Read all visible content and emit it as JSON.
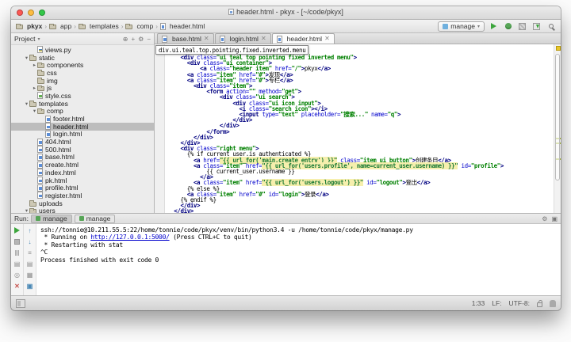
{
  "window": {
    "title": "header.html - pkyx - [~/code/pkyx]",
    "breadcrumbs": [
      "pkyx",
      "app",
      "templates",
      "comp",
      "header.html"
    ],
    "toolbar": {
      "run_config_label": "manage",
      "icons": [
        "run-icon",
        "debug-icon",
        "coverage-icon",
        "deploy-icon",
        "search-everywhere-icon"
      ]
    }
  },
  "project_panel": {
    "title": "Project",
    "header_icons": [
      "locate-icon",
      "scroll-to-source-icon",
      "gear-icon",
      "collapse-all-icon"
    ],
    "tree": [
      {
        "label": "views.py",
        "depth": 3,
        "icon": "py"
      },
      {
        "label": "static",
        "depth": 2,
        "icon": "folder",
        "arrow": "down"
      },
      {
        "label": "components",
        "depth": 3,
        "icon": "folder",
        "arrow": "right"
      },
      {
        "label": "css",
        "depth": 3,
        "icon": "folder"
      },
      {
        "label": "img",
        "depth": 3,
        "icon": "folder"
      },
      {
        "label": "js",
        "depth": 3,
        "icon": "folder",
        "arrow": "right"
      },
      {
        "label": "style.css",
        "depth": 3,
        "icon": "css"
      },
      {
        "label": "templates",
        "depth": 2,
        "icon": "folder",
        "arrow": "down"
      },
      {
        "label": "comp",
        "depth": 3,
        "icon": "folder",
        "arrow": "down"
      },
      {
        "label": "footer.html",
        "depth": 4,
        "icon": "html"
      },
      {
        "label": "header.html",
        "depth": 4,
        "icon": "html",
        "selected": true
      },
      {
        "label": "login.html",
        "depth": 4,
        "icon": "html"
      },
      {
        "label": "404.html",
        "depth": 3,
        "icon": "html"
      },
      {
        "label": "500.html",
        "depth": 3,
        "icon": "html"
      },
      {
        "label": "base.html",
        "depth": 3,
        "icon": "html"
      },
      {
        "label": "create.html",
        "depth": 3,
        "icon": "html"
      },
      {
        "label": "index.html",
        "depth": 3,
        "icon": "html"
      },
      {
        "label": "pk.html",
        "depth": 3,
        "icon": "html"
      },
      {
        "label": "profile.html",
        "depth": 3,
        "icon": "html"
      },
      {
        "label": "register.html",
        "depth": 3,
        "icon": "html"
      },
      {
        "label": "uploads",
        "depth": 2,
        "icon": "folder"
      },
      {
        "label": "users",
        "depth": 2,
        "icon": "folder",
        "arrow": "down"
      }
    ]
  },
  "editor": {
    "tabs": [
      {
        "label": "base.html",
        "active": false
      },
      {
        "label": "login.html",
        "active": false
      },
      {
        "label": "header.html",
        "active": true
      }
    ],
    "selector_popup": "div.ui.teal.top.pointing.fixed.inverted.menu",
    "colors": {
      "tag": "#000080",
      "attribute": "#0000cc",
      "value": "#008000",
      "injected_bg": "#f6efad"
    },
    "code_lines": [
      {
        "i": 4,
        "s": [
          [
            "t",
            "<div "
          ],
          [
            "a",
            "class="
          ],
          [
            "v",
            "\"ui teal top pointing fixed inverted menu\""
          ],
          [
            "t",
            ">"
          ]
        ]
      },
      {
        "i": 6,
        "s": [
          [
            "t",
            "<div "
          ],
          [
            "a",
            "class="
          ],
          [
            "v",
            "\"ui container\""
          ],
          [
            "t",
            ">"
          ]
        ]
      },
      {
        "i": 10,
        "s": [
          [
            "t",
            "<a "
          ],
          [
            "a",
            "class="
          ],
          [
            "v",
            "\"header item\""
          ],
          [
            "a",
            " href="
          ],
          [
            "v",
            "\"/\""
          ],
          [
            "t",
            ">"
          ],
          [
            "x",
            "pkyx"
          ],
          [
            "t",
            "</a>"
          ]
        ]
      },
      {
        "i": 6,
        "s": [
          [
            "t",
            "<a "
          ],
          [
            "a",
            "class="
          ],
          [
            "v",
            "\"item\""
          ],
          [
            "a",
            " href="
          ],
          [
            "v",
            "\"#\""
          ],
          [
            "t",
            ">"
          ],
          [
            "x",
            "发现"
          ],
          [
            "t",
            "</a>"
          ]
        ]
      },
      {
        "i": 6,
        "s": [
          [
            "t",
            "<a "
          ],
          [
            "a",
            "class="
          ],
          [
            "v",
            "\"item\""
          ],
          [
            "a",
            " href="
          ],
          [
            "v",
            "\"#\""
          ],
          [
            "t",
            ">"
          ],
          [
            "x",
            "专栏"
          ],
          [
            "t",
            "</a>"
          ]
        ]
      },
      {
        "i": 8,
        "s": [
          [
            "t",
            "<div "
          ],
          [
            "a",
            "class="
          ],
          [
            "v",
            "\"item\""
          ],
          [
            "t",
            ">"
          ]
        ]
      },
      {
        "i": 12,
        "s": [
          [
            "t",
            "<form "
          ],
          [
            "a",
            "action="
          ],
          [
            "v",
            "\"\""
          ],
          [
            "a",
            " method="
          ],
          [
            "v",
            "\"get\""
          ],
          [
            "t",
            ">"
          ]
        ]
      },
      {
        "i": 16,
        "s": [
          [
            "t",
            "<div "
          ],
          [
            "a",
            "class="
          ],
          [
            "v",
            "\"ui search\""
          ],
          [
            "t",
            ">"
          ]
        ]
      },
      {
        "i": 20,
        "s": [
          [
            "t",
            "<div "
          ],
          [
            "a",
            "class="
          ],
          [
            "v",
            "\"ui icon input\""
          ],
          [
            "t",
            ">"
          ]
        ]
      },
      {
        "i": 22,
        "s": [
          [
            "t",
            "<i "
          ],
          [
            "a",
            "class="
          ],
          [
            "v",
            "\"search icon\""
          ],
          [
            "t",
            "></i>"
          ]
        ]
      },
      {
        "i": 22,
        "s": [
          [
            "t",
            "<input "
          ],
          [
            "a",
            "type="
          ],
          [
            "v",
            "\"text\""
          ],
          [
            "a",
            " placeholder="
          ],
          [
            "v",
            "\"搜索...\""
          ],
          [
            "a",
            " name="
          ],
          [
            "v",
            "\"q\""
          ],
          [
            "t",
            ">"
          ]
        ]
      },
      {
        "i": 20,
        "s": [
          [
            "t",
            "</div>"
          ]
        ]
      },
      {
        "i": 16,
        "s": [
          [
            "t",
            "</div>"
          ]
        ]
      },
      {
        "i": 12,
        "s": [
          [
            "t",
            "</form>"
          ]
        ]
      },
      {
        "i": 8,
        "s": [
          [
            "t",
            "</div>"
          ]
        ]
      },
      {
        "i": 4,
        "s": [
          [
            "t",
            "</div>"
          ]
        ]
      },
      {
        "i": 4,
        "s": [
          [
            "t",
            "<div "
          ],
          [
            "a",
            "class="
          ],
          [
            "v",
            "\"right menu\""
          ],
          [
            "t",
            ">"
          ]
        ]
      },
      {
        "i": 6,
        "s": [
          [
            "j",
            "{% if current_user.is_authenticated %}"
          ]
        ]
      },
      {
        "i": 8,
        "s": [
          [
            "t",
            "<a "
          ],
          [
            "a",
            "href="
          ],
          [
            "h",
            "\"{{ url_for('main.create_entry') }}\""
          ],
          [
            "a",
            " class="
          ],
          [
            "v",
            "\"item ui button\""
          ],
          [
            "t",
            ">"
          ],
          [
            "x",
            "创建条目"
          ],
          [
            "t",
            "</a>"
          ]
        ]
      },
      {
        "i": 8,
        "s": [
          [
            "t",
            "<a "
          ],
          [
            "a",
            "class="
          ],
          [
            "v",
            "\"item\""
          ],
          [
            "a",
            " href="
          ],
          [
            "h",
            "\"{{ url_for('users.profile', name=current_user.username) }}\""
          ],
          [
            "a",
            " id="
          ],
          [
            "v",
            "\"profile\""
          ],
          [
            "t",
            ">"
          ]
        ]
      },
      {
        "i": 12,
        "s": [
          [
            "j",
            "{{ current_user.username }}"
          ]
        ]
      },
      {
        "i": 10,
        "s": [
          [
            "t",
            "</a>"
          ]
        ]
      },
      {
        "i": 8,
        "s": [
          [
            "t",
            "<a "
          ],
          [
            "a",
            "class="
          ],
          [
            "v",
            "\"item\""
          ],
          [
            "a",
            " href="
          ],
          [
            "h",
            "\"{{ url_for('users.logout') }}\""
          ],
          [
            "a",
            " id="
          ],
          [
            "v",
            "\"logout\""
          ],
          [
            "t",
            ">"
          ],
          [
            "x",
            "登出"
          ],
          [
            "t",
            "</a>"
          ]
        ]
      },
      {
        "i": 6,
        "s": [
          [
            "j",
            "{% else %}"
          ]
        ]
      },
      {
        "i": 6,
        "s": [
          [
            "t",
            "<a "
          ],
          [
            "a",
            "class="
          ],
          [
            "v",
            "\"item\""
          ],
          [
            "a",
            " href="
          ],
          [
            "v",
            "\"#\""
          ],
          [
            "a",
            " id="
          ],
          [
            "v",
            "\"login\""
          ],
          [
            "t",
            ">"
          ],
          [
            "x",
            "登录"
          ],
          [
            "t",
            "</a>"
          ]
        ]
      },
      {
        "i": 4,
        "s": [
          [
            "j",
            "{% endif %}"
          ]
        ]
      },
      {
        "i": 4,
        "s": [
          [
            "t",
            "</div>"
          ]
        ]
      },
      {
        "i": 2,
        "s": [
          [
            "t",
            "</div>"
          ]
        ]
      }
    ]
  },
  "run_panel": {
    "label": "Run:",
    "tabs": [
      {
        "label": "manage",
        "active": true
      },
      {
        "label": "manage",
        "active": false
      }
    ],
    "header_icons": [
      "gear-icon",
      "dock-icon"
    ],
    "toolbar_left": [
      "rerun-icon",
      "stop-icon",
      "pause-output-icon",
      "show-console-icon",
      "pin-tab-icon",
      "close-icon"
    ],
    "toolbar_right": [
      "up-stack-icon",
      "down-stack-icon",
      "soft-wrap-icon",
      "scroll-to-end-icon",
      "print-icon",
      "clear-all-icon"
    ],
    "console_lines": [
      {
        "s": [
          [
            "c",
            "ssh://tonnie@10.211.55.5:22/home/tonnie/code/pkyx/venv/bin/python3.4 -u /home/tonnie/code/pkyx/manage.py"
          ]
        ]
      },
      {
        "s": [
          [
            "c",
            " * Running on "
          ],
          [
            "l",
            "http://127.0.0.1:5000/"
          ],
          [
            "c",
            " (Press CTRL+C to quit)"
          ]
        ]
      },
      {
        "s": [
          [
            "c",
            " * Restarting with stat"
          ]
        ]
      },
      {
        "s": [
          [
            "c",
            "^C"
          ]
        ]
      },
      {
        "s": [
          [
            "c",
            "Process finished with exit code 0"
          ]
        ]
      }
    ]
  },
  "status_bar": {
    "position": "1:33",
    "line_separator": "LF:",
    "encoding": "UTF-8:"
  }
}
